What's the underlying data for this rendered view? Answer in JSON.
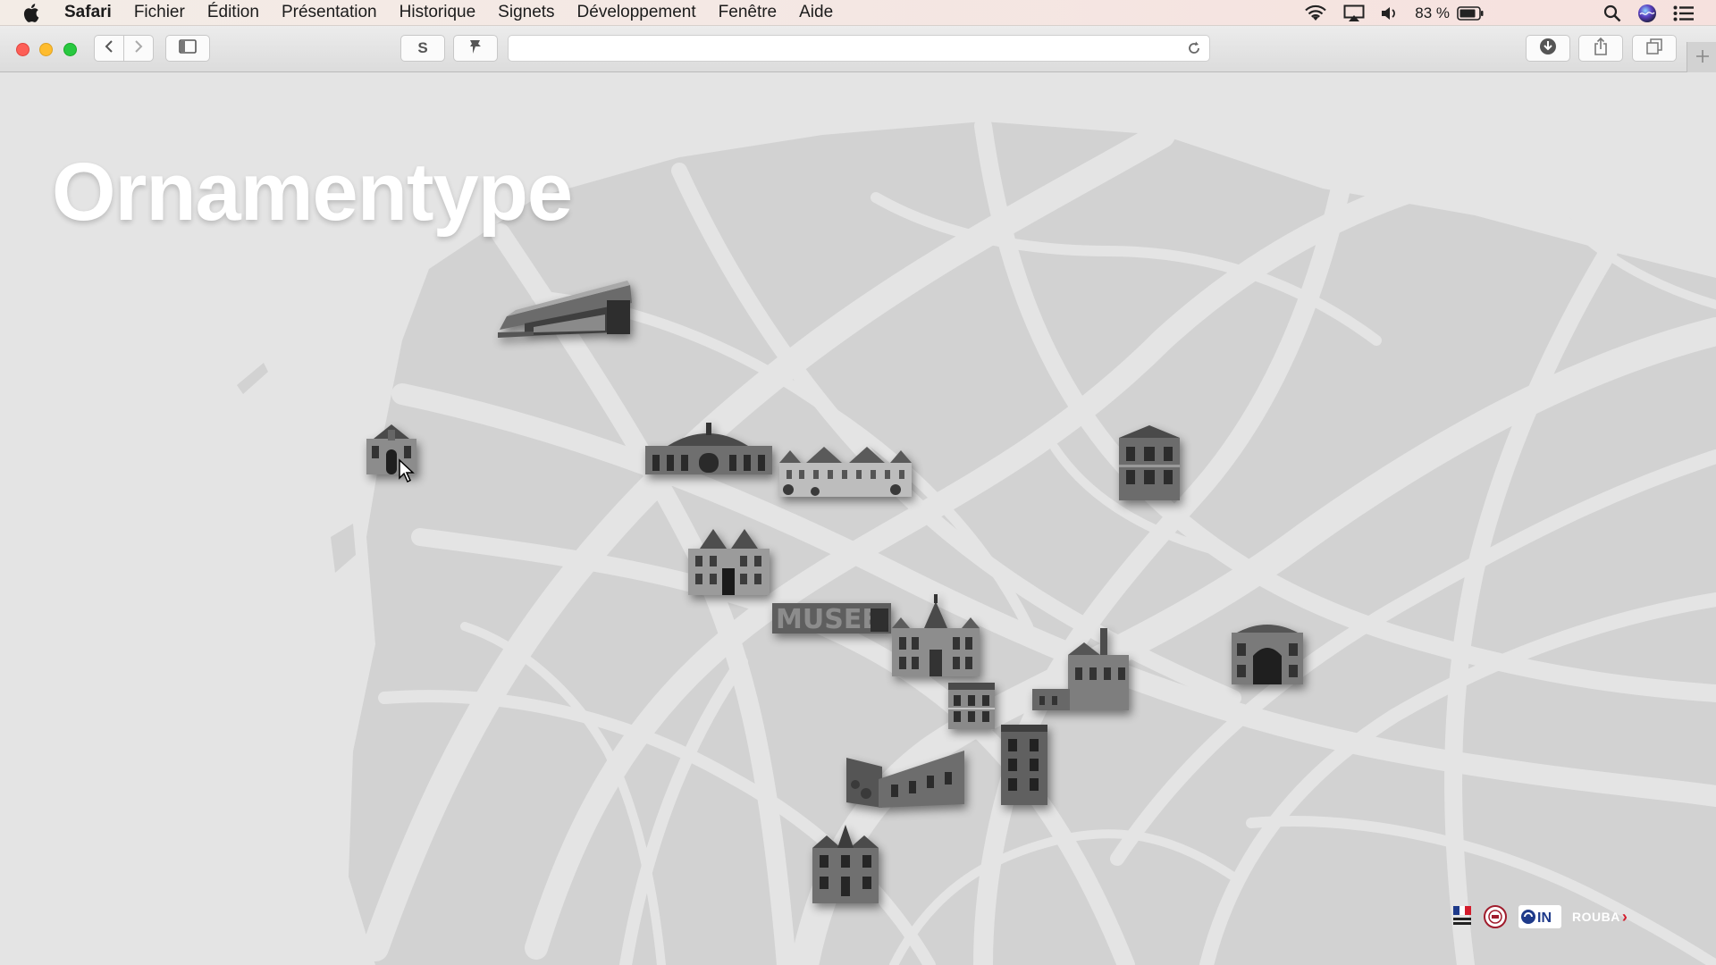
{
  "menubar": {
    "app_name": "Safari",
    "menus": [
      "Fichier",
      "Édition",
      "Présentation",
      "Historique",
      "Signets",
      "Développement",
      "Fenêtre",
      "Aide"
    ],
    "battery_percent": "83 %",
    "icons": [
      "apple-icon",
      "wifi-icon",
      "airplay-icon",
      "volume-icon",
      "battery-icon",
      "spotlight-icon",
      "siri-icon",
      "notification-center-icon"
    ]
  },
  "toolbar": {
    "url": "",
    "extension_s_label": "S",
    "icons": [
      "back-icon",
      "forward-icon",
      "sidebar-icon",
      "pin-icon",
      "reload-icon",
      "downloads-icon",
      "share-icon",
      "tabs-icon",
      "new-tab-icon"
    ]
  },
  "page": {
    "title": "Ornamentype",
    "buildings": [
      "modern-cantilever-building",
      "chapel-facade",
      "station-hall",
      "chateau-facade",
      "ornate-mansion",
      "museum-sign-building",
      "town-hall-belfry",
      "red-brick-tower-house",
      "gate-arch-building",
      "small-facade",
      "factory-chimney",
      "brick-row-houses",
      "narrow-tall-house",
      "brick-villa"
    ],
    "footer_logos": {
      "roubaix_label": "ROUBA",
      "roubaix_chevron": "›"
    }
  },
  "colors": {
    "background": "#e4e4e4",
    "map_blocks": "#d2d2d2",
    "title": "#ffffff"
  }
}
